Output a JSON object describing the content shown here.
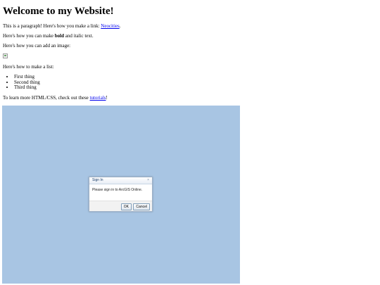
{
  "heading": "Welcome to my Website!",
  "para1": {
    "text": "This is a paragraph! Here's how you make a link: ",
    "link": "Neocities",
    "end": "."
  },
  "para2": {
    "pre": "Here's how you can make ",
    "bold": "bold",
    "post": " and italic text."
  },
  "para3": "Here's how you can add an image:",
  "para4": "Here's how to make a list:",
  "list": [
    "First thing",
    "Second thing",
    "Third thing"
  ],
  "para5": {
    "text": "To learn more HTML/CSS, check out these ",
    "link": "tutorials",
    "end": "!"
  },
  "map": {
    "background": "#a8c5e3"
  },
  "dialog": {
    "title": "Sign In",
    "close_glyph": "×",
    "message": "Please sign in to ArcGIS Online.",
    "ok_label": "OK",
    "cancel_label": "Cancel"
  }
}
